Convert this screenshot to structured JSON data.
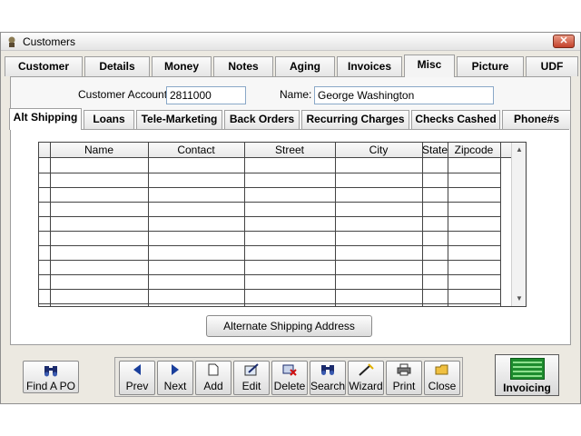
{
  "window": {
    "title": "Customers",
    "close_label": "✕"
  },
  "main_tabs": [
    "Customer",
    "Details",
    "Money",
    "Notes",
    "Aging",
    "Invoices",
    "Misc",
    "Picture",
    "UDF"
  ],
  "form": {
    "account_label": "Customer Account:",
    "account_value": "2811000",
    "name_label": "Name:",
    "name_value": "George Washington"
  },
  "sub_tabs": [
    "Alt Shipping",
    "Loans",
    "Tele-Marketing",
    "Back Orders",
    "Recurring Charges",
    "Checks Cashed",
    "Phone#s"
  ],
  "grid": {
    "columns": [
      "Name",
      "Contact",
      "Street",
      "City",
      "State",
      "Zipcode"
    ],
    "rows": 10
  },
  "alt_button_label": "Alternate Shipping Address",
  "find_po_label": "Find A PO",
  "toolbar": {
    "buttons": [
      {
        "label": "Prev",
        "icon": "arrow-left-icon"
      },
      {
        "label": "Next",
        "icon": "arrow-right-icon"
      },
      {
        "label": "Add",
        "icon": "page-icon"
      },
      {
        "label": "Edit",
        "icon": "edit-icon"
      },
      {
        "label": "Delete",
        "icon": "delete-icon"
      },
      {
        "label": "Search",
        "icon": "binoculars-icon"
      },
      {
        "label": "Wizard",
        "icon": "wand-icon"
      },
      {
        "label": "Print",
        "icon": "printer-icon"
      },
      {
        "label": "Close",
        "icon": "folder-icon"
      }
    ]
  },
  "invoicing_label": "Invoicing",
  "colors": {
    "accent": "#1e8c2e",
    "field_border": "#8aa8c8",
    "nav_arrow": "#1a3f9c"
  }
}
